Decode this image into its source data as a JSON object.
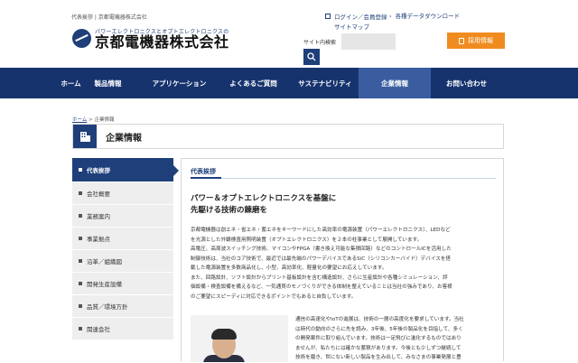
{
  "header": {
    "breadcrumb_top": "代表挨拶 | 京都電機器株式会社",
    "logo_tagline": "パワーエレクトロニクスとオプトエレクトロニクスの",
    "logo_name": "京都電機器株式会社",
    "login_link": "ログイン／会員登録",
    "download_link": "各種データダウンロード",
    "sitemap_link": "サイトマップ",
    "search_label": "サイト内検索",
    "search_placeholder": "",
    "recruit_label": "採用情報"
  },
  "nav": {
    "items": [
      "ホーム",
      "製品情報",
      "アプリケーション",
      "よくあるご質問",
      "サステナビリティ",
      "企業情報",
      "お問い合わせ"
    ],
    "active": "企業情報"
  },
  "breadcrumb": {
    "home": "ホーム",
    "sep": ">",
    "current": "企業情報"
  },
  "page_title": "企業情報",
  "sidebar": {
    "items": [
      "代表挨拶",
      "会社概要",
      "業務案内",
      "事業拠点",
      "沿革／組織図",
      "開発生産設備",
      "品質／環境方針",
      "関連会社"
    ],
    "active": "代表挨拶"
  },
  "content": {
    "tab_label": "代表挨拶",
    "headline_1": "パワー＆オプトエレクトロニクスを基盤に",
    "headline_2": "先駆ける技術の錬磨を",
    "paragraph_lines": [
      "京都電機器は創エネ・省エネ・蓄エネをキーワードにした高効率の電源装置（パワーエレクトロニクス）、LEDなど",
      "を光源とした外観検査用照明装置（オプトエレクトロニクス）を２本の柱事業として展開しています。",
      "高電圧、高周波スイッチング技術、マイコンやFPGA（書き換え可能な集積回路）などのコントロールICを活用した",
      "制御技術は、当社のコア技術で、最近では最先端のパワーデバイスであるSiC（シリコンカーバイド）デバイスを搭",
      "載した電源装置を多数商品化し、小型、高効率化、軽量化の要望にお応えしています。",
      "また、回路設計、ソフト設計からプリント基板設計を含む構造設計、さらに生産設計や各種シミュレーション、評",
      "価設備・検査設備を備えるなど、一気通貫のモノづくりができる体制を整えていることは当社の強みであり、お客様",
      "のご要望にスピーディに対応できるポイントでもあると自負しています。"
    ],
    "ceo_lines": [
      "通信の高速化やIoTの進展は、技術の一層の高度化を要求しています。当社",
      "は時代の動向のさらに先を読み、3年後、5年後の製品化を目指して、多く",
      "の開発案件に取り組んでいます。技術は一足飛びに進化するものではあり",
      "ませんが、私たちには確かな蓄積があります。今後とも少しずつ継続して",
      "技術を磨き、世にない新しい製品を生み出して、みなさまの事業発展と豊"
    ]
  },
  "colors": {
    "navy": "#16336e",
    "accent": "#1e3f7a",
    "orange": "#f08c1f",
    "active_nav": "#3a5da0"
  }
}
